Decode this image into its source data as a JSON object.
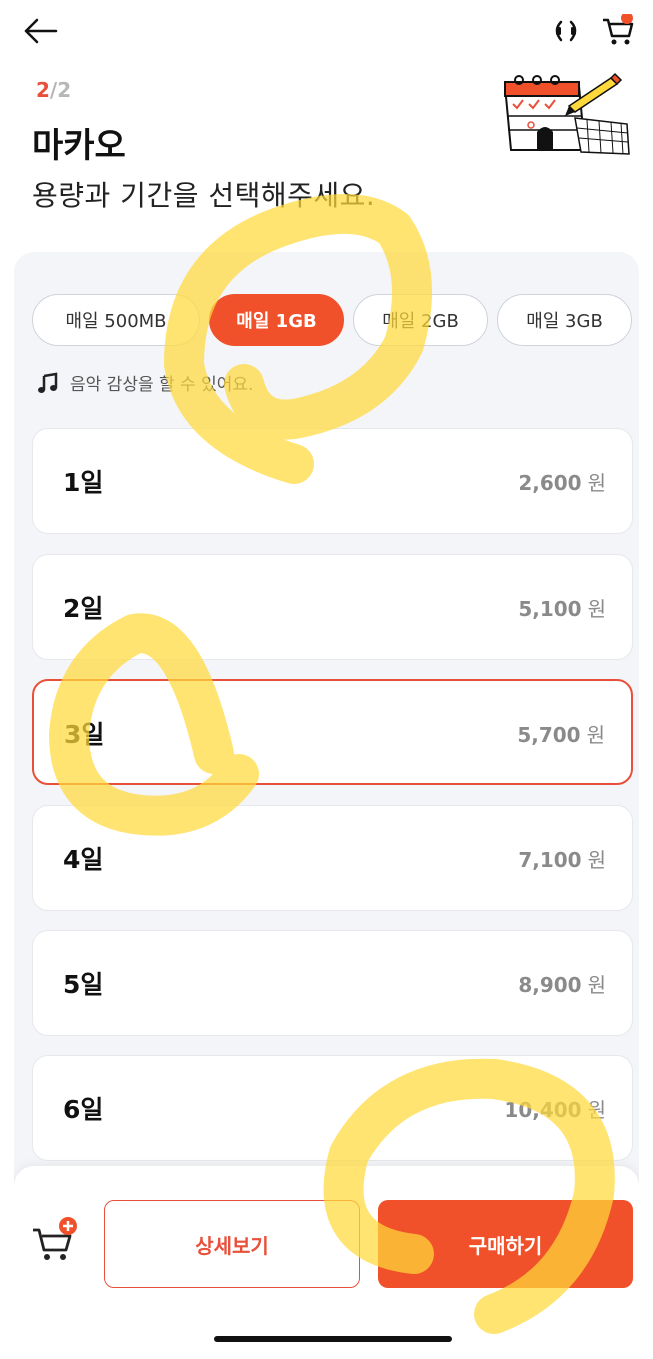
{
  "header": {
    "step_current": "2",
    "step_total": "/2",
    "title": "마카오",
    "subtitle": "용량과 기간을 선택해주세요."
  },
  "icons": {
    "back": "arrow-left-icon",
    "sound": "sound-icon",
    "cart": "cart-icon",
    "illustration": "calendar-pencil-illustration",
    "music": "music-note-icon",
    "cart_add": "cart-add-icon"
  },
  "plans": [
    {
      "label": "매일 500MB",
      "active": false
    },
    {
      "label": "매일 1GB",
      "active": true
    },
    {
      "label": "매일 2GB",
      "active": false
    },
    {
      "label": "매일 3GB",
      "active": false
    }
  ],
  "note": "음악 감상을 할 수 있어요.",
  "durations": [
    {
      "day": "1일",
      "price": "2,600",
      "unit": "원",
      "selected": false
    },
    {
      "day": "2일",
      "price": "5,100",
      "unit": "원",
      "selected": false
    },
    {
      "day": "3일",
      "price": "5,700",
      "unit": "원",
      "selected": true
    },
    {
      "day": "4일",
      "price": "7,100",
      "unit": "원",
      "selected": false
    },
    {
      "day": "5일",
      "price": "8,900",
      "unit": "원",
      "selected": false
    },
    {
      "day": "6일",
      "price": "10,400",
      "unit": "원",
      "selected": false
    }
  ],
  "bottom": {
    "detail_label": "상세보기",
    "buy_label": "구매하기"
  },
  "colors": {
    "accent": "#f0512a",
    "accent_dark": "#e8503a",
    "panel_bg": "#f4f5f8",
    "price_gray": "#8a8a8a",
    "highlight_marker": "#ffd93b"
  }
}
